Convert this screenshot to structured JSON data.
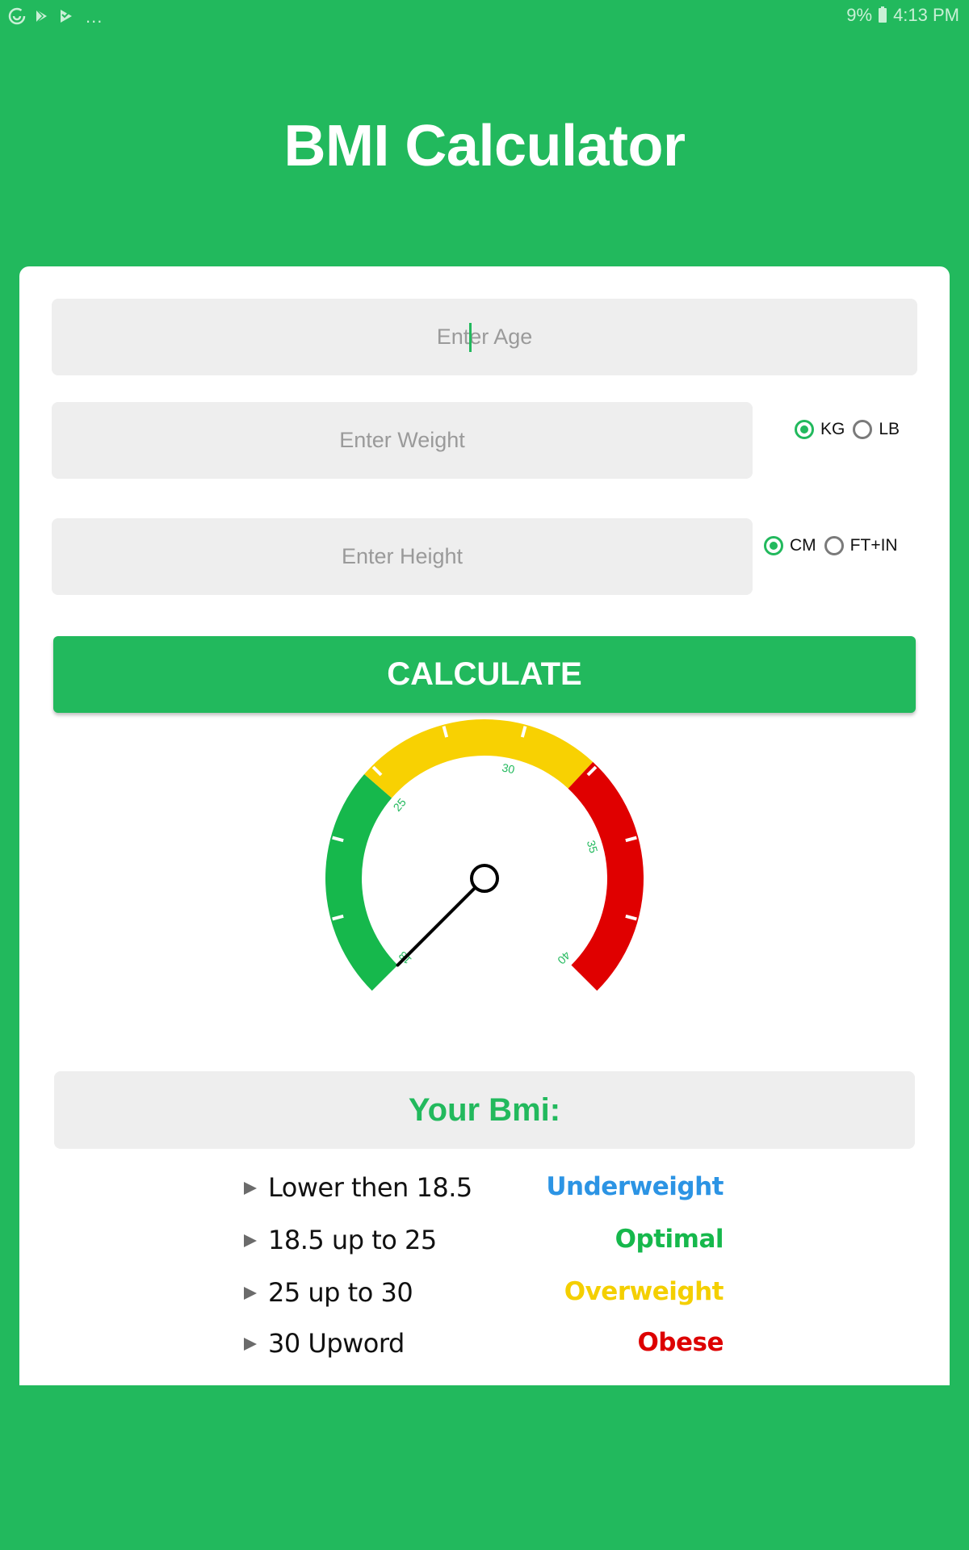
{
  "status_bar": {
    "icons_left": [
      "sync-icon",
      "play-store-icon",
      "play-store-check-icon"
    ],
    "overflow": "...",
    "battery": "9%",
    "time": "4:13 PM"
  },
  "app": {
    "title": "BMI Calculator"
  },
  "form": {
    "age": {
      "placeholder": "Enter Age",
      "value": ""
    },
    "weight": {
      "placeholder": "Enter Weight",
      "value": ""
    },
    "height": {
      "placeholder": "Enter Height",
      "value": ""
    },
    "weight_units": [
      {
        "label": "KG",
        "checked": true
      },
      {
        "label": "LB",
        "checked": false
      }
    ],
    "height_units": [
      {
        "label": "CM",
        "checked": true
      },
      {
        "label": "FT+IN",
        "checked": false
      }
    ],
    "calculate_label": "CALCULATE"
  },
  "gauge": {
    "min": 18,
    "max": 40,
    "value": 18,
    "labels": [
      "18",
      "25",
      "30",
      "35",
      "40"
    ],
    "segments": [
      {
        "from": 18,
        "to": 25,
        "color": "#16b84c"
      },
      {
        "from": 25,
        "to": 32.5,
        "color": "#f8d102"
      },
      {
        "from": 32.5,
        "to": 40,
        "color": "#e00000"
      }
    ],
    "label_color": "#22b95d"
  },
  "result": {
    "label": "Your Bmi:"
  },
  "legend": [
    {
      "range": "Lower then 18.5",
      "status": "Underweight",
      "color": "#2c94e4"
    },
    {
      "range": "18.5 up to 25",
      "status": "Optimal",
      "color": "#16b84c"
    },
    {
      "range": "25 up to 30",
      "status": "Overweight",
      "color": "#f4cf00"
    },
    {
      "range": "30 Upword",
      "status": "Obese",
      "color": "#dd0000"
    }
  ],
  "colors": {
    "brand": "#22b95d",
    "field_bg": "#eeeeee"
  }
}
